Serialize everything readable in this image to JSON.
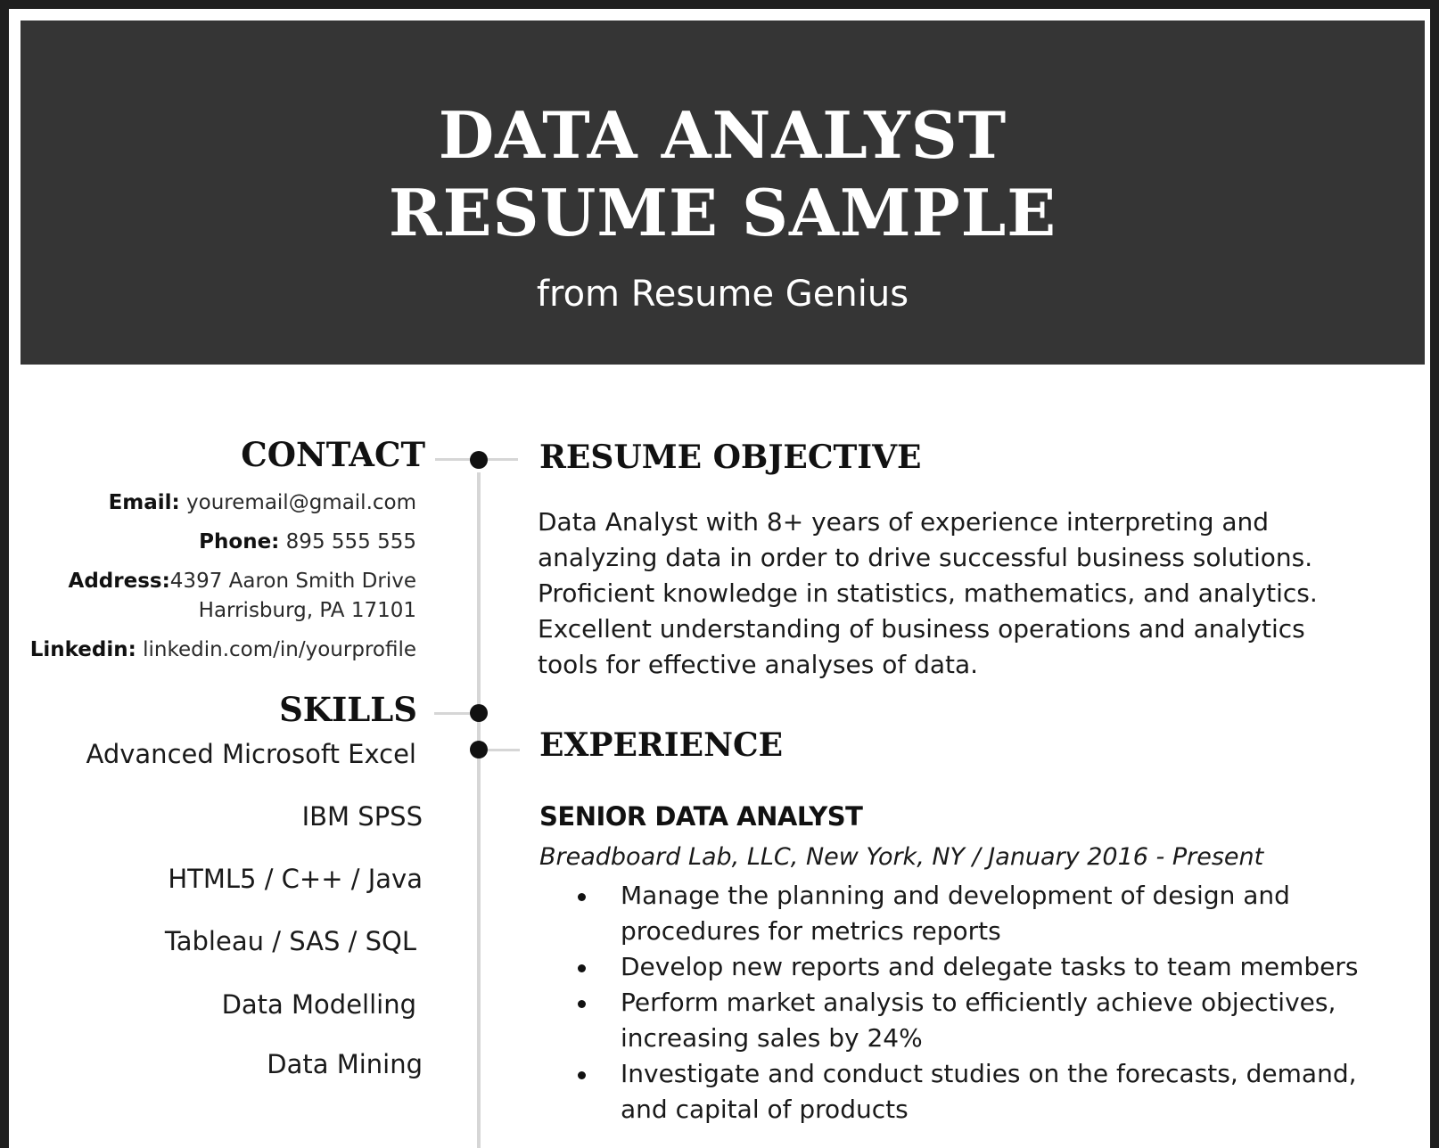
{
  "header": {
    "title_line1": "DATA ANALYST",
    "title_line2": "RESUME SAMPLE",
    "subtitle": "from Resume Genius"
  },
  "contact": {
    "heading": "CONTACT",
    "email_label": "Email:",
    "email": "youremail@gmail.com",
    "phone_label": "Phone:",
    "phone": "895 555 555",
    "address_label": "Address:",
    "address_line1": "4397 Aaron Smith Drive",
    "address_line2": "Harrisburg, PA 17101",
    "linkedin_label": "Linkedin:",
    "linkedin": "linkedin.com/in/yourprofile"
  },
  "skills": {
    "heading": "SKILLS",
    "items": [
      "Advanced Microsoft Excel",
      "IBM SPSS",
      "HTML5 / C++ / Java",
      "Tableau / SAS / SQL",
      "Data Modelling",
      "Data Mining"
    ]
  },
  "objective": {
    "heading": "RESUME OBJECTIVE",
    "text": "Data Analyst with 8+ years of experience interpreting and analyzing data in order to drive successful business solutions. Proficient knowledge in statistics, mathematics, and analytics. Excellent understanding of business operations and analytics tools for effective analyses of data."
  },
  "experience": {
    "heading": "EXPERIENCE",
    "jobs": [
      {
        "title": "SENIOR DATA ANALYST",
        "meta": "Breadboard Lab, LLC, New York, NY  /  January 2016 - Present",
        "bullets": [
          "Manage the planning and development of design and procedures for metrics reports",
          "Develop new reports and delegate tasks to team members",
          "Perform market analysis to efficiently achieve objectives, increasing sales by 24%",
          "Investigate and conduct studies on the forecasts, demand, and capital of products"
        ]
      }
    ]
  }
}
